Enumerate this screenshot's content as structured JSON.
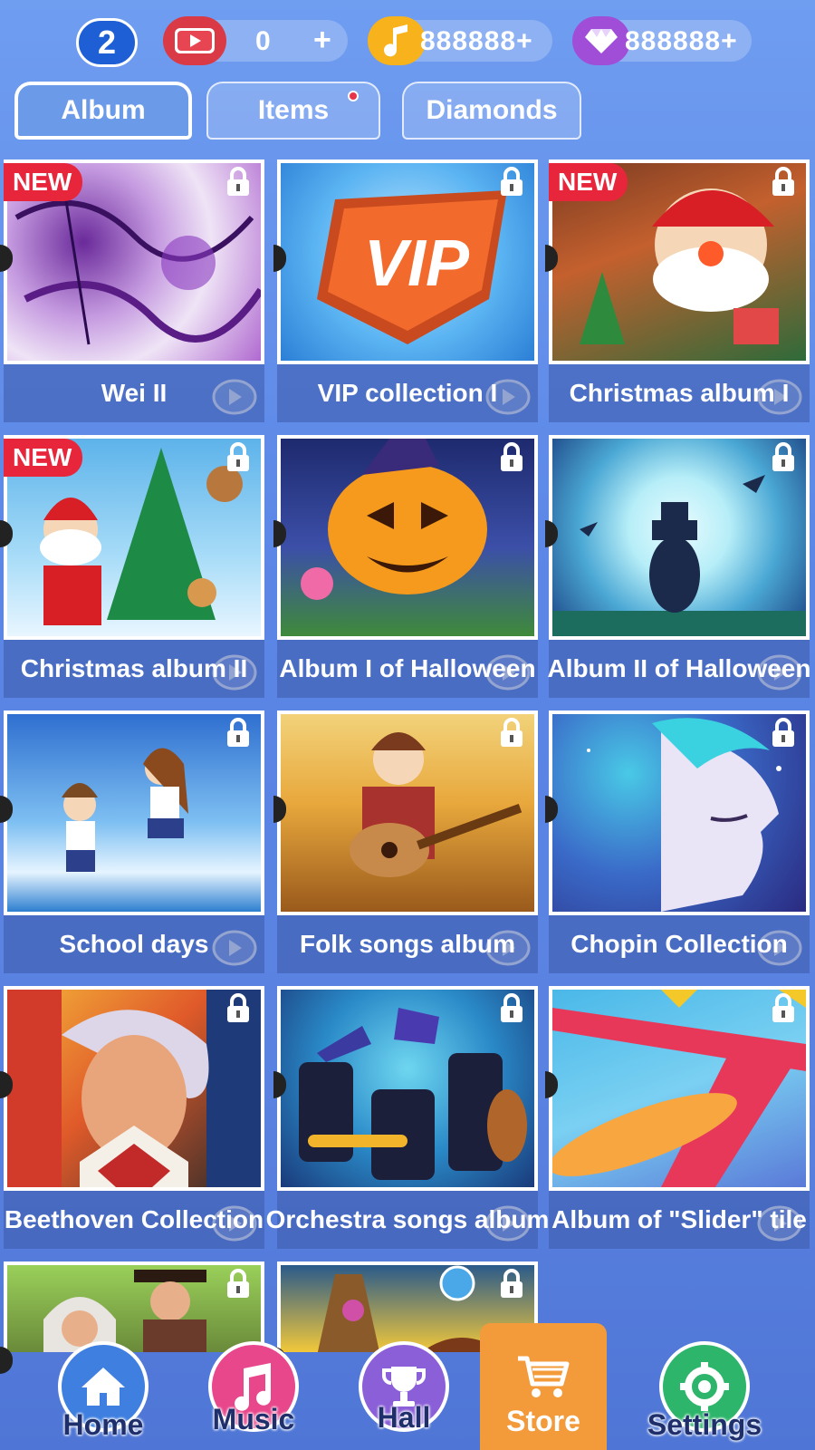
{
  "topbar": {
    "level": "2",
    "tickets": {
      "value": "0",
      "plus": "+"
    },
    "coins": {
      "value": "888888+"
    },
    "diamonds": {
      "value": "888888+"
    }
  },
  "tabs": [
    {
      "label": "Album",
      "active": true
    },
    {
      "label": "Items",
      "active": false,
      "has_dot": true
    },
    {
      "label": "Diamonds",
      "active": false
    }
  ],
  "badges": {
    "new": "NEW"
  },
  "albums": [
    {
      "title": "Wei II",
      "new": true,
      "locked": true
    },
    {
      "title": "VIP collection I",
      "new": false,
      "locked": true
    },
    {
      "title": "Christmas album I",
      "new": true,
      "locked": true
    },
    {
      "title": "Christmas album II",
      "new": true,
      "locked": true
    },
    {
      "title": "Album I of Halloween",
      "new": false,
      "locked": true
    },
    {
      "title": "Album II of Halloween",
      "new": false,
      "locked": true
    },
    {
      "title": "School days",
      "new": false,
      "locked": true
    },
    {
      "title": "Folk songs album",
      "new": false,
      "locked": true
    },
    {
      "title": "Chopin Collection",
      "new": false,
      "locked": true
    },
    {
      "title": "Beethoven Collection",
      "new": false,
      "locked": true
    },
    {
      "title": "Orchestra songs album",
      "new": false,
      "locked": true
    },
    {
      "title": "Album of \"Slider\" tile",
      "new": false,
      "locked": true
    },
    {
      "title": "",
      "new": false,
      "locked": true
    },
    {
      "title": "",
      "new": false,
      "locked": true
    }
  ],
  "nav": [
    {
      "label": "Home",
      "icon": "home-icon",
      "color": "#3f7fe0"
    },
    {
      "label": "Music",
      "icon": "music-note-icon",
      "color": "#e8478c"
    },
    {
      "label": "Hall",
      "icon": "trophy-icon",
      "color": "#8b5fd8"
    },
    {
      "label": "Store",
      "icon": "cart-icon",
      "color": "#f39a3b",
      "active": true
    },
    {
      "label": "Settings",
      "icon": "gear-icon",
      "color": "#2db56b"
    }
  ]
}
